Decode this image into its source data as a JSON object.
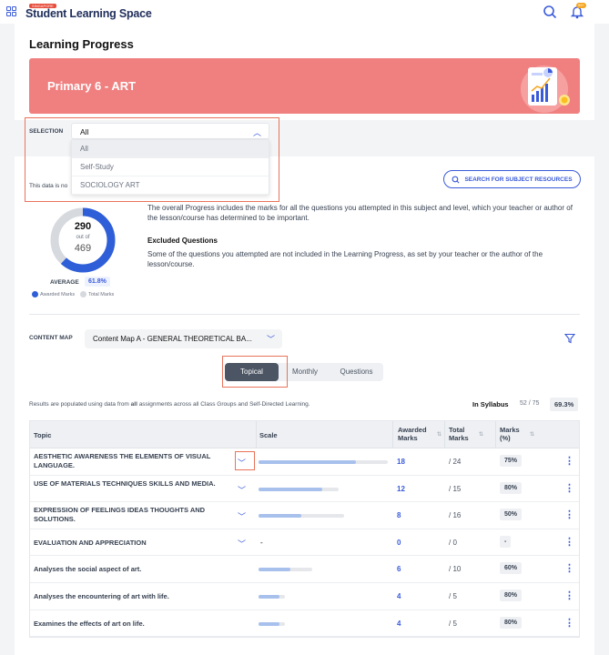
{
  "header": {
    "logo_small": "SINGAPORE",
    "logo_text": "Student Learning Space",
    "notification_badge": "99+",
    "icons": [
      "grid-icon",
      "search-icon",
      "bell-icon"
    ]
  },
  "page": {
    "title": "Learning Progress",
    "banner_title": "Primary 6 - ART"
  },
  "selection": {
    "label": "SELECTION",
    "value": "All",
    "options": [
      "All",
      "Self-Study",
      "SOCIOLOGY ART"
    ]
  },
  "note": "This data is no",
  "search_resources_label": "SEARCH FOR SUBJECT RESOURCES",
  "progress": {
    "awarded": "290",
    "out_of": "out of",
    "total": "469",
    "average_label": "AVERAGE",
    "average_value": "61.8%",
    "legend_awarded": "Awarded Marks",
    "legend_total": "Total Marks",
    "fraction": 0.618
  },
  "description": {
    "overall": "The overall Progress includes the marks for all the questions you attempted in this subject and level, which your teacher or author of the lesson/course has determined to be important.",
    "excluded_title": "Excluded Questions",
    "excluded": "Some of the questions you attempted are not included in the Learning Progress, as set by your teacher or the author of the lesson/course."
  },
  "content_map": {
    "label": "CONTENT MAP",
    "value": "Content Map A - GENERAL THEORETICAL BA..."
  },
  "tabs": [
    "Topical",
    "Monthly",
    "Questions"
  ],
  "results": {
    "prefix": "Results are populated using data from ",
    "bold": "all",
    "suffix": " assignments across all Class Groups and Self-Directed Learning.",
    "in_syllabus_label": "In Syllabus",
    "in_syllabus_count": "52 / 75",
    "in_syllabus_pct": "69.3%"
  },
  "table": {
    "headers": {
      "topic": "Topic",
      "scale": "Scale",
      "awarded": "Awarded Marks",
      "total": "Total Marks",
      "marks_pct": "Marks (%)"
    },
    "rows": [
      {
        "topic": "AESTHETIC AWARENESS THE ELEMENTS OF VISUAL LANGUAGE.",
        "expandable": true,
        "awarded": "18",
        "total": "/ 24",
        "pct": "75%",
        "fraction": 0.75,
        "track": 0.98
      },
      {
        "topic": "USE OF MATERIALS TECHNIQUES SKILLS AND MEDIA.",
        "expandable": true,
        "awarded": "12",
        "total": "/ 15",
        "pct": "80%",
        "fraction": 0.8,
        "track": 0.61
      },
      {
        "topic": "EXPRESSION OF FEELINGS IDEAS THOUGHTS AND SOLUTIONS.",
        "expandable": true,
        "awarded": "8",
        "total": "/ 16",
        "pct": "50%",
        "fraction": 0.5,
        "track": 0.65
      },
      {
        "topic": "EVALUATION AND APPRECIATION",
        "expandable": true,
        "scale_text": "-",
        "awarded": "0",
        "total": "/ 0",
        "pct": "-",
        "fraction": 0,
        "track": 0
      },
      {
        "topic": "Analyses the social aspect of art.",
        "expandable": false,
        "awarded": "6",
        "total": "/ 10",
        "pct": "60%",
        "fraction": 0.6,
        "track": 0.41
      },
      {
        "topic": "Analyses the encountering of art with life.",
        "expandable": false,
        "awarded": "4",
        "total": "/ 5",
        "pct": "80%",
        "fraction": 0.8,
        "track": 0.2
      },
      {
        "topic": "Examines the effects of art on life.",
        "expandable": false,
        "awarded": "4",
        "total": "/ 5",
        "pct": "80%",
        "fraction": 0.8,
        "track": 0.2
      }
    ]
  },
  "colors": {
    "accent": "#3a5bd9",
    "banner": "#f08080",
    "highlight": "#e8735a"
  }
}
